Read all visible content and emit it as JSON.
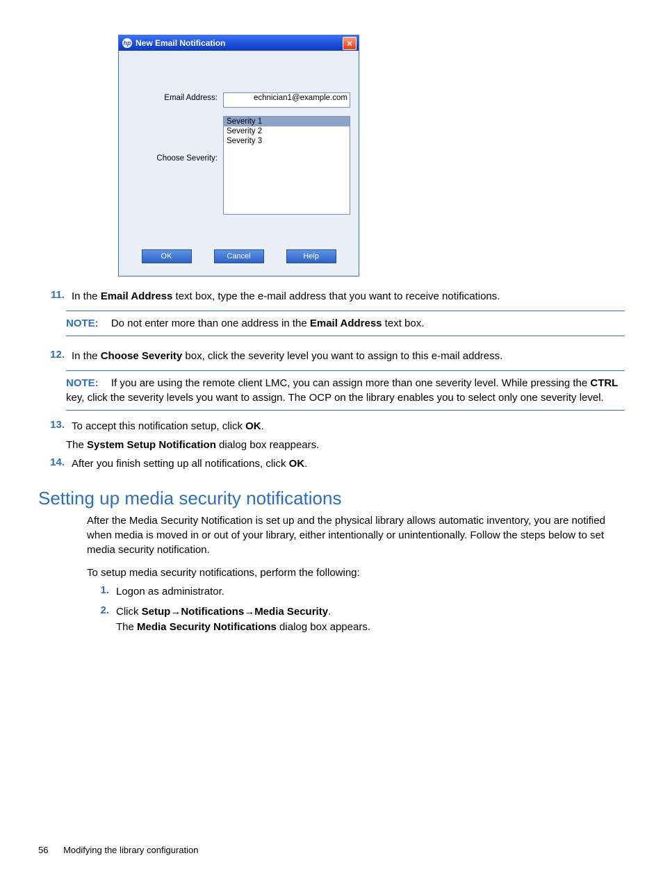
{
  "dialog": {
    "title": "New Email Notification",
    "email_label": "Email Address:",
    "email_value": "echnician1@example.com",
    "severity_label": "Choose Severity:",
    "severity_options": [
      "Severity 1",
      "Severity 2",
      "Severity 3"
    ],
    "ok": "OK",
    "cancel": "Cancel",
    "help": "Help"
  },
  "steps": {
    "s11_num": "11.",
    "s11_a": "In the ",
    "s11_b": "Email Address",
    "s11_c": " text box, type the e-mail address that you want to receive notifications.",
    "s11_note_label": "NOTE:",
    "s11_note_a": "Do not enter more than one address in the ",
    "s11_note_b": "Email Address",
    "s11_note_c": " text box.",
    "s12_num": "12.",
    "s12_a": "In the ",
    "s12_b": "Choose Severity",
    "s12_c": " box, click the severity level you want to assign to this e-mail address.",
    "s12_note_label": "NOTE:",
    "s12_note_a": "If you are using the remote client LMC, you can assign more than one severity level. While pressing the ",
    "s12_note_b": "CTRL",
    "s12_note_c": " key, click the severity levels you want to assign. The OCP on the library enables you to select only one severity level.",
    "s13_num": "13.",
    "s13_a": "To accept this notification setup, click ",
    "s13_b": "OK",
    "s13_c": ".",
    "s13_sub_a": "The ",
    "s13_sub_b": "System Setup Notification",
    "s13_sub_c": " dialog box reappears.",
    "s14_num": "14.",
    "s14_a": "After you finish setting up all notifications, click ",
    "s14_b": "OK",
    "s14_c": "."
  },
  "section": {
    "heading": "Setting up media security notifications",
    "p1": "After the Media Security Notification is set up and the physical library allows automatic inventory, you are notified when media is moved in or out of your library, either intentionally or unintentionally. Follow the steps below to set media security notification.",
    "p2": "To setup media security notifications, perform the following:",
    "o1_num": "1.",
    "o1": "Logon as administrator.",
    "o2_num": "2.",
    "o2_a": "Click ",
    "o2_b": "Setup",
    "o2_c": "Notifications",
    "o2_d": "Media Security",
    "o2_e": ".",
    "o2_sub_a": "The ",
    "o2_sub_b": "Media Security Notifications",
    "o2_sub_c": " dialog box appears."
  },
  "footer": {
    "page": "56",
    "chapter": "Modifying the library configuration"
  }
}
